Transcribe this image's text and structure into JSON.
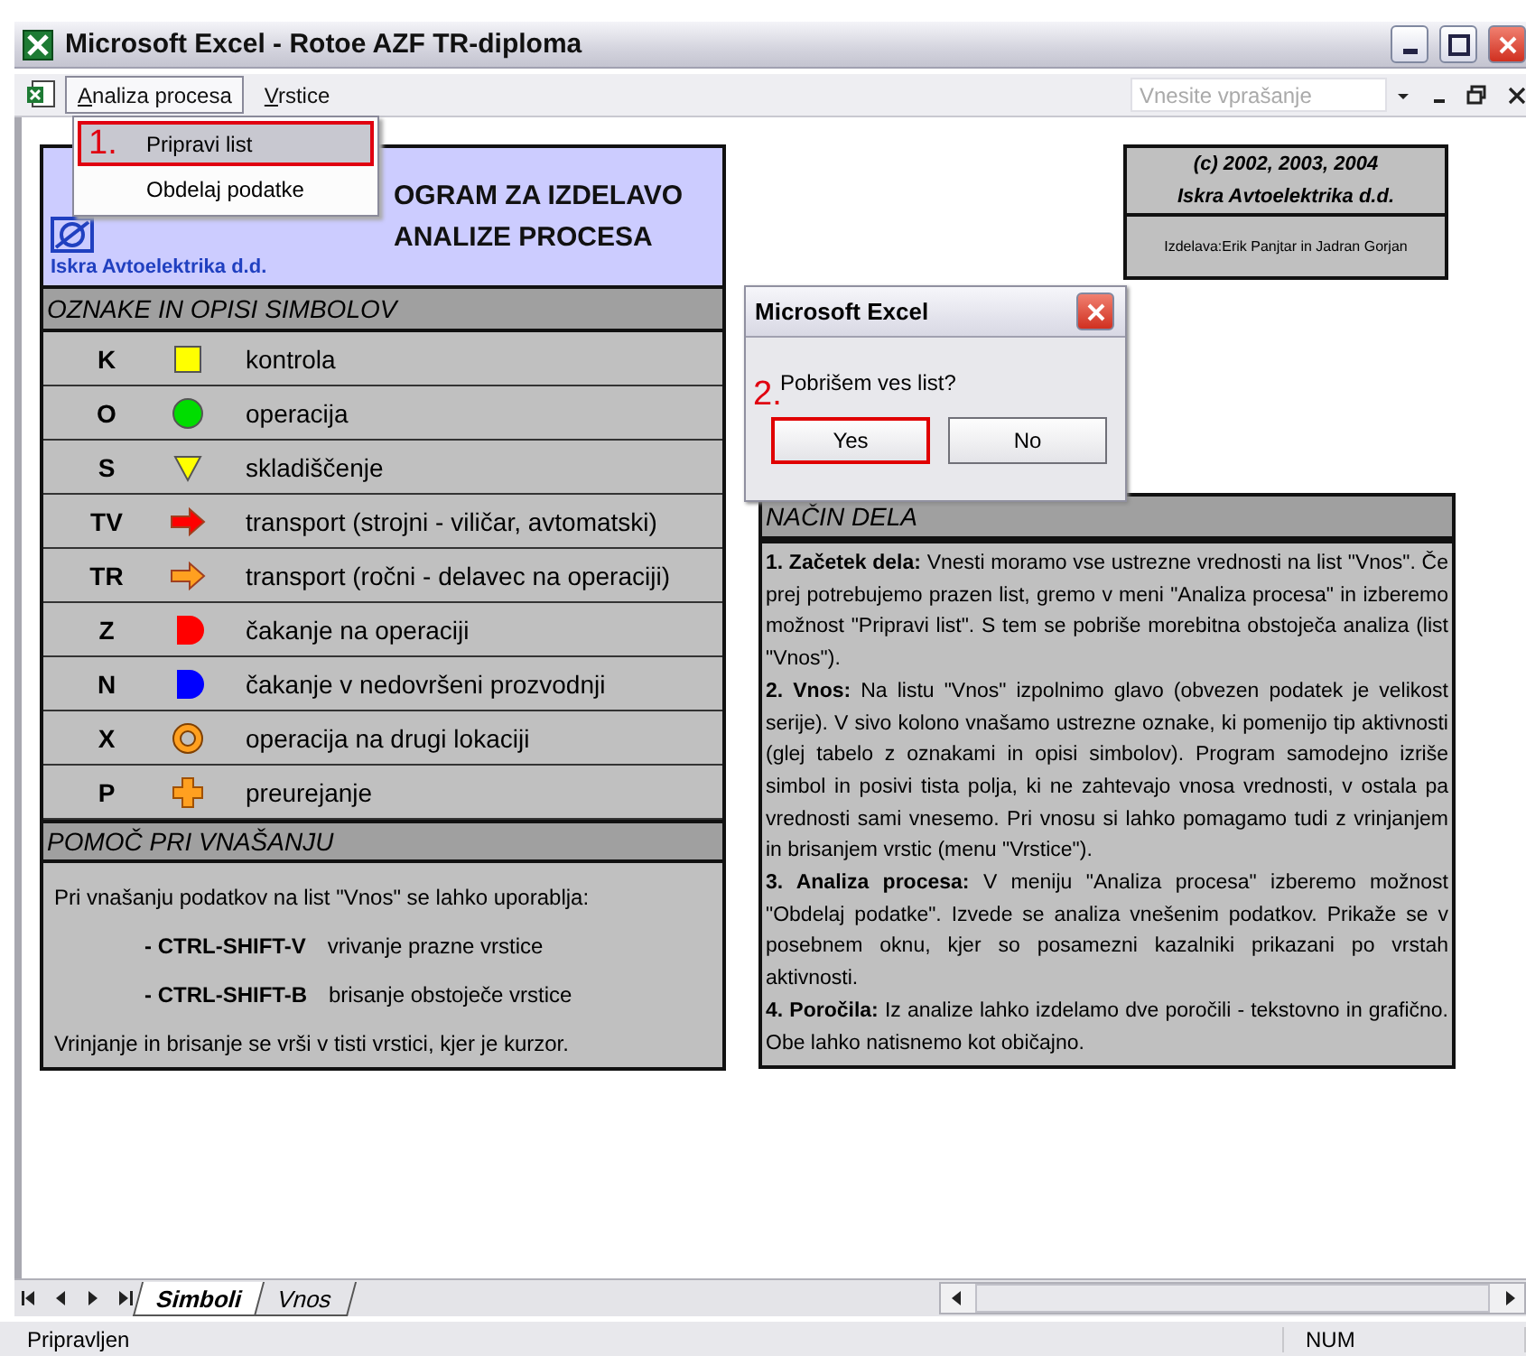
{
  "window": {
    "title": "Microsoft Excel - Rotoe AZF TR-diploma"
  },
  "menu_bar": {
    "items": [
      {
        "label": "Analiza procesa",
        "selected": true
      },
      {
        "label": "Vrstice",
        "selected": false
      }
    ],
    "help_field": {
      "placeholder": "Vnesite vprašanje"
    }
  },
  "open_menu": {
    "items": [
      {
        "label": "Pripravi list",
        "highlighted": true,
        "annotation": "1."
      },
      {
        "label": "Obdelaj podatke",
        "highlighted": false
      }
    ]
  },
  "header": {
    "company": "Iskra Avtoelektrika d.d.",
    "title_lines": [
      "OGRAM ZA IZDELAVO",
      "ANALIZE PROCESA"
    ]
  },
  "symbols": {
    "title": "OZNAKE IN OPISI SIMBOLOV",
    "rows": [
      {
        "code": "K",
        "kind": "square",
        "color": "#ffff00",
        "description": "kontrola"
      },
      {
        "code": "O",
        "kind": "circle",
        "color": "#00dd00",
        "description": "operacija"
      },
      {
        "code": "S",
        "kind": "triangle",
        "color": "#ffff00",
        "description": "skladiščenje"
      },
      {
        "code": "TV",
        "kind": "arrow",
        "color": "#ff0000",
        "description": "transport (strojni - viličar, avtomatski)"
      },
      {
        "code": "TR",
        "kind": "arrow",
        "color": "#ffa020",
        "description": "transport (ročni - delavec na operaciji)"
      },
      {
        "code": "Z",
        "kind": "delay",
        "color": "#ff0000",
        "description": "čakanje na operaciji"
      },
      {
        "code": "N",
        "kind": "delay",
        "color": "#0000ff",
        "description": "čakanje v nedovršeni prozvodnji"
      },
      {
        "code": "X",
        "kind": "ring",
        "color": "#ffa020",
        "description": "operacija na drugi lokaciji"
      },
      {
        "code": "P",
        "kind": "cross",
        "color": "#ffa020",
        "description": "preurejanje"
      }
    ]
  },
  "help": {
    "title": "POMOČ PRI VNAŠANJU",
    "intro": "Pri vnašanju podatkov na list \"Vnos\" se lahko uporablja:",
    "shortcuts": [
      {
        "keys": "- CTRL-SHIFT-V",
        "action": "vrivanje prazne vrstice"
      },
      {
        "keys": "- CTRL-SHIFT-B",
        "action": "brisanje obstoječe vrstice"
      }
    ],
    "footer": "Vrinjanje in brisanje se vrši v tisti vrstici, kjer je kurzor."
  },
  "copyright": {
    "lines": [
      "(c) 2002, 2003, 2004",
      "Iskra Avtoelektrika d.d."
    ],
    "authors": "Izdelava:Erik Panjtar in Jadran Gorjan"
  },
  "method": {
    "title": "NAČIN DELA",
    "paragraphs": [
      "**1. Začetek dela:** Vnesti moramo vse ustrezne vrednosti na list \"Vnos\". Če prej potrebujemo prazen list, gremo v meni \"Analiza procesa\" in izberemo možnost \"Pripravi list\". S tem se pobriše morebitna obstoječa analiza (list \"Vnos\").",
      "**2. Vnos:** Na listu \"Vnos\" izpolnimo glavo (obvezen podatek je velikost serije). V sivo kolono vnašamo ustrezne oznake, ki pomenijo tip aktivnosti (glej tabelo z oznakami in opisi simbolov). Program samodejno izriše simbol in posivi tista polja, ki ne zahtevajo vnosa vrednosti, v ostala pa vrednosti sami vnesemo. Pri vnosu si lahko pomagamo tudi z vrinjanjem in brisanjem vrstic (menu \"Vrstice\").",
      "**3. Analiza procesa:** V meniju \"Analiza procesa\" izberemo možnost \"Obdelaj podatke\". Izvede se analiza vnešenim podatkov. Prikaže se v posebnem oknu, kjer so posamezni kazalniki prikazani po vrstah aktivnosti.",
      "**4. Poročila:** Iz analize lahko izdelamo dve poročili - tekstovno in grafično. Obe lahko natisnemo kot običajno."
    ]
  },
  "dialog": {
    "title": "Microsoft Excel",
    "message": "Pobrišem ves list?",
    "annotation": "2.",
    "buttons": [
      {
        "label": "Yes",
        "highlighted": true
      },
      {
        "label": "No",
        "highlighted": false
      }
    ]
  },
  "sheet_tabs": [
    {
      "label": "Simboli",
      "selected": true
    },
    {
      "label": "Vnos",
      "selected": false
    }
  ],
  "status_bar": {
    "text": "Pripravljen",
    "indicators": [
      "NUM"
    ]
  }
}
